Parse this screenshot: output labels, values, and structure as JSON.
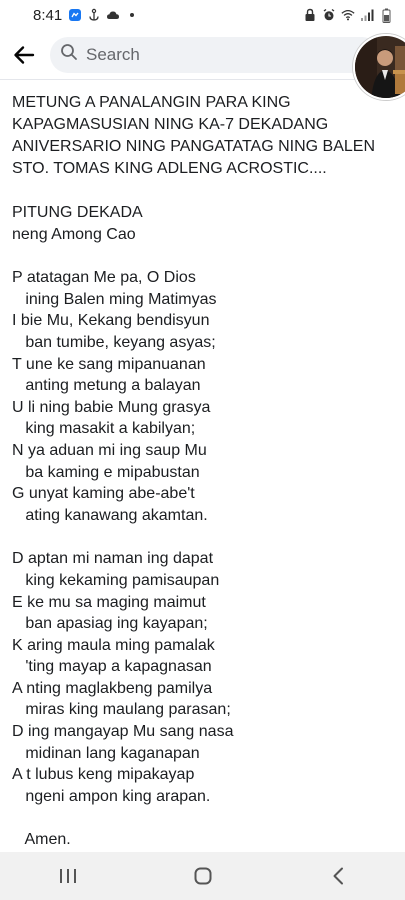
{
  "status": {
    "time": "8:41"
  },
  "search": {
    "placeholder": "Search"
  },
  "post": {
    "title": "METUNG  A PANALANGIN PARA KING\nKAPAGMASUSIAN NING KA-7 DEKADANG\nANIVERSARIO NING PANGATATAG NING BALEN\nSTO. TOMAS KING ADLENG ACROSTIC....",
    "subtitle_lines": [
      "PITUNG DEKADA",
      "neng Among Cao"
    ],
    "stanza1": [
      "P atatagan Me pa, O Dios",
      "   ining Balen ming Matimyas",
      "I bie Mu, Kekang bendisyun",
      "   ban tumibe, keyang asyas;",
      "T une ke sang mipanuanan",
      "   anting metung a balayan",
      "U li ning babie Mung grasya",
      "   king masakit a kabilyan;",
      "N ya aduan mi ing saup Mu",
      "   ba kaming e mipabustan",
      "G unyat kaming abe-abe't",
      "   ating kanawang akamtan."
    ],
    "stanza2": [
      "D aptan mi naman ing dapat",
      "   king kekaming pamisaupan",
      "E ke mu sa maging maimut",
      "   ban apasiag ing kayapan;",
      "K aring maula ming pamalak",
      "   'ting mayap a kapagnasan",
      "A nting maglakbeng pamilya",
      "   miras king maulang parasan;",
      "D ing mangayap Mu sang nasa",
      "   midinan lang kaganapan",
      "A t lubus keng mipakayap",
      "   ngeni ampon king arapan."
    ],
    "closing": "   Amen."
  }
}
